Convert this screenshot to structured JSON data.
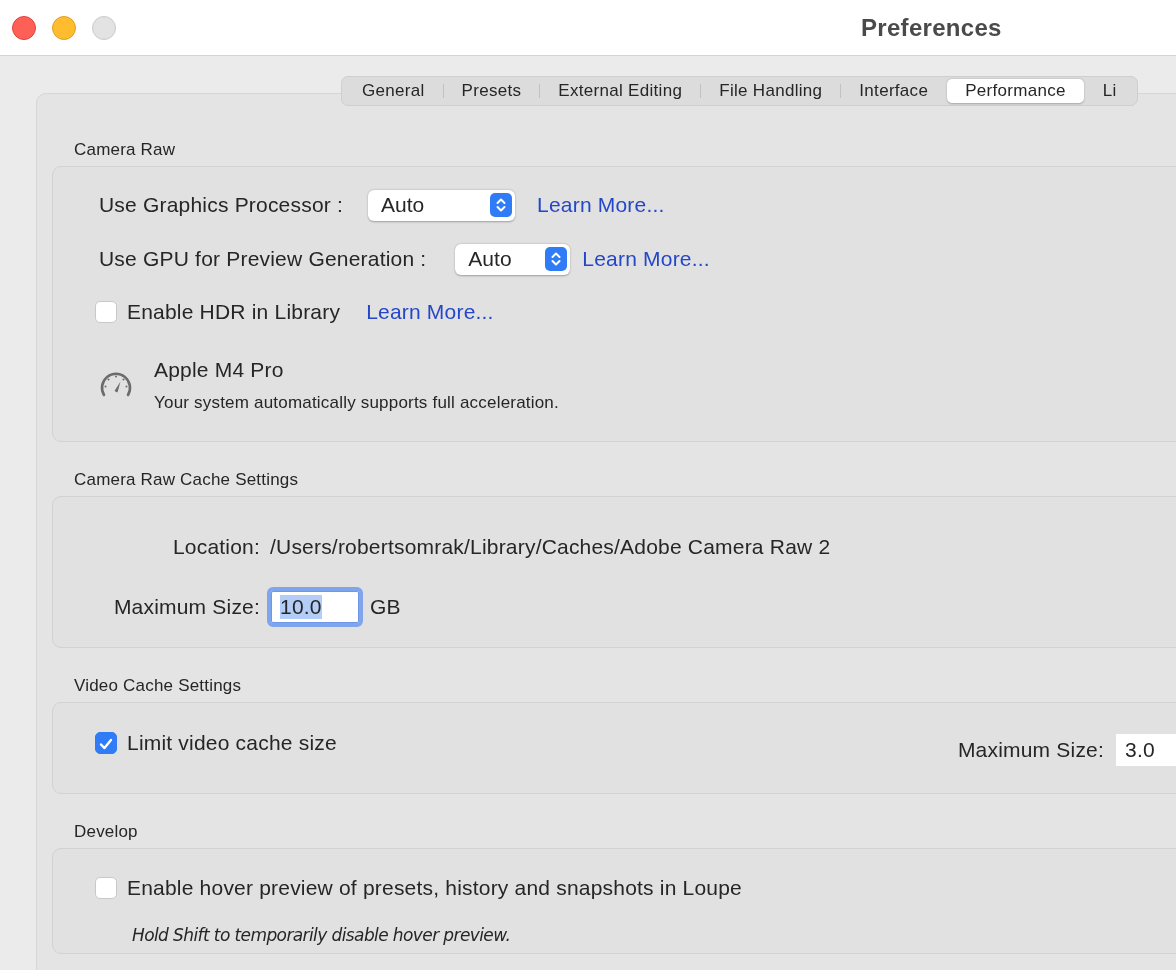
{
  "window": {
    "title": "Preferences"
  },
  "tabs": [
    {
      "label": "General",
      "selected": false
    },
    {
      "label": "Presets",
      "selected": false
    },
    {
      "label": "External Editing",
      "selected": false
    },
    {
      "label": "File Handling",
      "selected": false
    },
    {
      "label": "Interface",
      "selected": false
    },
    {
      "label": "Performance",
      "selected": true
    },
    {
      "label": "Li",
      "selected": false
    }
  ],
  "sections": [
    {
      "title": "Camera Raw",
      "rows": [
        {
          "kind": "popup",
          "label": "Use Graphics Processor :",
          "value": "Auto",
          "link": "Learn More..."
        },
        {
          "kind": "popup",
          "label": "Use GPU for Preview Generation :",
          "value": "Auto",
          "link": "Learn More..."
        },
        {
          "kind": "checkbox",
          "label": "Enable HDR in Library",
          "checked": false,
          "link": "Learn More..."
        },
        {
          "kind": "info",
          "title": "Apple M4 Pro",
          "text": "Your system automatically supports full acceleration."
        }
      ]
    },
    {
      "title": "Camera Raw Cache Settings",
      "rows": [
        {
          "kind": "path",
          "label": "Location:",
          "value": "/Users/robertsomrak/Library/Caches/Adobe Camera Raw 2"
        },
        {
          "kind": "size",
          "label": "Maximum Size:",
          "value": "10.0",
          "unit": "GB",
          "focused": true
        }
      ]
    },
    {
      "title": "Video Cache Settings",
      "rows": [
        {
          "kind": "checkbox_size",
          "label": "Limit video cache size",
          "checked": true,
          "size_label": "Maximum Size:",
          "size_value": "3.0"
        }
      ]
    },
    {
      "title": "Develop",
      "rows": [
        {
          "kind": "checkbox",
          "label": "Enable hover preview of presets, history and snapshots in Loupe",
          "checked": false
        },
        {
          "kind": "hint",
          "text": "Hold Shift to temporarily disable hover preview."
        }
      ]
    }
  ]
}
